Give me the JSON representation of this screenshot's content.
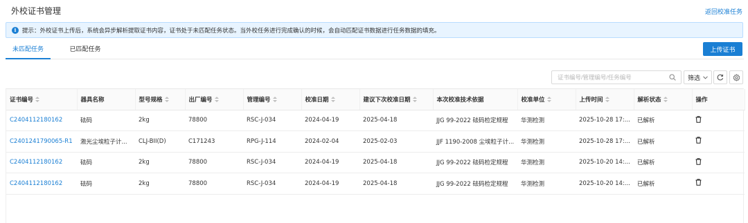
{
  "header": {
    "title": "外校证书管理",
    "back_link": "返回校准任务"
  },
  "alert": {
    "icon": "info-icon",
    "text": "提示：外校证书上传后，系统会异步解析提取证书内容，证书处于未匹配任务状态。当外校任务进行完成确认的时候，会自动匹配证书数据进行任务数据的填充。"
  },
  "tabs": [
    {
      "label": "未匹配任务",
      "active": true
    },
    {
      "label": "已匹配任务",
      "active": false
    }
  ],
  "toolbar": {
    "upload_label": "上传证书",
    "search_placeholder": "证书编号/管理编号/任务编号",
    "filter_label": "筛选",
    "accent_color": "#1a7fd4"
  },
  "table": {
    "columns": [
      "证书编号",
      "器具名称",
      "型号规格",
      "出厂编号",
      "管理编号",
      "校准日期",
      "建议下次校准日期",
      "本次校准技术依据",
      "校准单位",
      "上传时间",
      "解析状态",
      "操作"
    ],
    "rows": [
      [
        "C2404112180162",
        "砝码",
        "2kg",
        "78800",
        "RSC-J-034",
        "2024-04-19",
        "2025-04-18",
        "JJG 99-2022 砝码检定规程",
        "华测检测",
        "2025-10-28 17:...",
        "已解析"
      ],
      [
        "C2401241790065-R1",
        "激光尘埃粒子计...",
        "CLJ-BII(D)",
        "C171243",
        "RPG-J-114",
        "2024-02-04",
        "2025-02-03",
        "JJF 1190-2008 尘埃粒子计...",
        "华测检测",
        "2025-10-28 17:...",
        "已解析"
      ],
      [
        "C2404112180162",
        "砝码",
        "2kg",
        "78800",
        "RSC-J-034",
        "2024-04-19",
        "2025-04-18",
        "JJG 99-2022 砝码检定规程",
        "华测检测",
        "2025-10-20 14:...",
        "已解析"
      ],
      [
        "C2404112180162",
        "砝码",
        "2kg",
        "78800",
        "RSC-J-034",
        "2024-04-19",
        "2025-04-18",
        "JJG 99-2022 砝码检定规程",
        "华测检测",
        "2025-10-20 14:...",
        "已解析"
      ]
    ]
  }
}
